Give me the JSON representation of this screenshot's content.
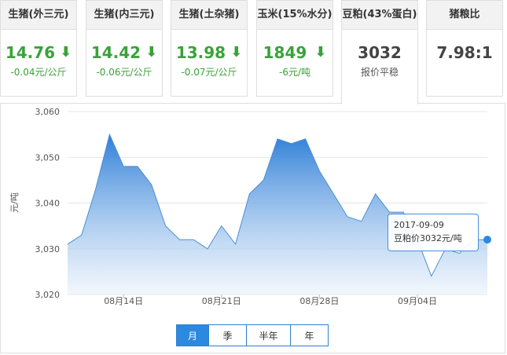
{
  "cards": [
    {
      "title": "生猪(外三元)",
      "price": "14.76",
      "change": "-0.04元/公斤",
      "arrow": "⬇",
      "trend": "down"
    },
    {
      "title": "生猪(内三元)",
      "price": "14.42",
      "change": "-0.06元/公斤",
      "arrow": "⬇",
      "trend": "down"
    },
    {
      "title": "生猪(土杂猪)",
      "price": "13.98",
      "change": "-0.07元/公斤",
      "arrow": "⬇",
      "trend": "down"
    },
    {
      "title": "玉米(15%水分)",
      "price": "1849",
      "change": "-6元/吨",
      "arrow": "⬇",
      "trend": "down"
    },
    {
      "title": "豆粕(43%蛋白)",
      "price": "3032",
      "change": "报价平稳",
      "arrow": "",
      "trend": "flat"
    },
    {
      "title": "猪粮比",
      "price": "7.98:1",
      "change": "",
      "arrow": "",
      "trend": "flat"
    }
  ],
  "active_card": 4,
  "colors": {
    "down": "#3aa23a",
    "accent": "#2b8ae0",
    "area_top": "#2f7fd8",
    "area_bottom": "#e8f1fb"
  },
  "tooltip": {
    "date": "2017-09-09",
    "label": "豆粕价3032元/吨"
  },
  "range_buttons": [
    "月",
    "季",
    "半年",
    "年"
  ],
  "selected_range": "月",
  "chart_data": {
    "type": "area",
    "ylabel": "元/吨",
    "ylim": [
      3020,
      3060
    ],
    "yticks": [
      "3,060",
      "3,050",
      "3,040",
      "3,030",
      "3,020"
    ],
    "xtick_labels": [
      "08月14日",
      "08月21日",
      "08月28日",
      "09月04日"
    ],
    "grid": true,
    "series": [
      {
        "x": [
          "08-10",
          "08-11",
          "08-12",
          "08-13",
          "08-14",
          "08-15",
          "08-16",
          "08-17",
          "08-18",
          "08-19",
          "08-20",
          "08-21",
          "08-22",
          "08-23",
          "08-24",
          "08-25",
          "08-26",
          "08-27",
          "08-28",
          "08-29",
          "08-30",
          "08-31",
          "09-01",
          "09-02",
          "09-03",
          "09-04",
          "09-05",
          "09-06",
          "09-07",
          "09-08",
          "09-09"
        ],
        "values": [
          3031,
          3033,
          3043,
          3055,
          3048,
          3048,
          3044,
          3035,
          3032,
          3032,
          3030,
          3035,
          3031,
          3042,
          3045,
          3054,
          3053,
          3054,
          3047,
          3042,
          3037,
          3036,
          3042,
          3038,
          3038,
          3032,
          3024,
          3030,
          3029,
          3032,
          3032
        ]
      }
    ]
  }
}
